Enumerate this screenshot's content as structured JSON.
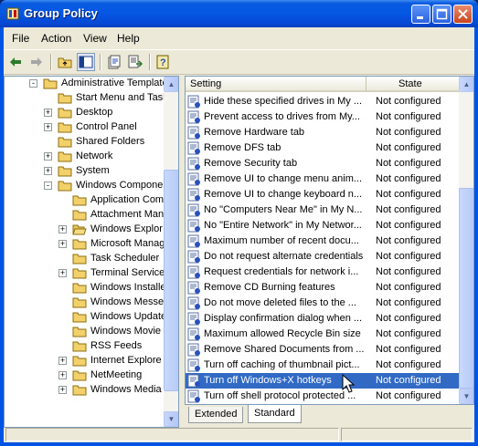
{
  "window": {
    "title": "Group Policy"
  },
  "menu": [
    "File",
    "Action",
    "View",
    "Help"
  ],
  "tree": [
    {
      "label": "Administrative Template",
      "indent": 2,
      "exp": "-"
    },
    {
      "label": "Start Menu and Taskb",
      "indent": 3,
      "exp": ""
    },
    {
      "label": "Desktop",
      "indent": 3,
      "exp": "+"
    },
    {
      "label": "Control Panel",
      "indent": 3,
      "exp": "+"
    },
    {
      "label": "Shared Folders",
      "indent": 3,
      "exp": ""
    },
    {
      "label": "Network",
      "indent": 3,
      "exp": "+"
    },
    {
      "label": "System",
      "indent": 3,
      "exp": "+"
    },
    {
      "label": "Windows Componen",
      "indent": 3,
      "exp": "-"
    },
    {
      "label": "Application Com",
      "indent": 4,
      "exp": ""
    },
    {
      "label": "Attachment Man",
      "indent": 4,
      "exp": ""
    },
    {
      "label": "Windows Explor",
      "indent": 4,
      "exp": "+",
      "open": true
    },
    {
      "label": "Microsoft Manag",
      "indent": 4,
      "exp": "+"
    },
    {
      "label": "Task Scheduler",
      "indent": 4,
      "exp": ""
    },
    {
      "label": "Terminal Service",
      "indent": 4,
      "exp": "+"
    },
    {
      "label": "Windows Installe",
      "indent": 4,
      "exp": ""
    },
    {
      "label": "Windows Messe",
      "indent": 4,
      "exp": ""
    },
    {
      "label": "Windows Update",
      "indent": 4,
      "exp": ""
    },
    {
      "label": "Windows Movie",
      "indent": 4,
      "exp": ""
    },
    {
      "label": "RSS Feeds",
      "indent": 4,
      "exp": ""
    },
    {
      "label": "Internet Explore",
      "indent": 4,
      "exp": "+"
    },
    {
      "label": "NetMeeting",
      "indent": 4,
      "exp": "+"
    },
    {
      "label": "Windows Media",
      "indent": 4,
      "exp": "+"
    }
  ],
  "list": {
    "col_setting": "Setting",
    "col_state": "State",
    "rows": [
      {
        "name": "Hide these specified drives in My ...",
        "state": "Not configured"
      },
      {
        "name": "Prevent access to drives from My...",
        "state": "Not configured"
      },
      {
        "name": "Remove Hardware tab",
        "state": "Not configured"
      },
      {
        "name": "Remove DFS tab",
        "state": "Not configured"
      },
      {
        "name": "Remove Security tab",
        "state": "Not configured"
      },
      {
        "name": "Remove UI to change menu anim...",
        "state": "Not configured"
      },
      {
        "name": "Remove UI to change keyboard n...",
        "state": "Not configured"
      },
      {
        "name": "No \"Computers Near Me\" in My N...",
        "state": "Not configured"
      },
      {
        "name": "No \"Entire Network\" in My Networ...",
        "state": "Not configured"
      },
      {
        "name": "Maximum number of recent docu...",
        "state": "Not configured"
      },
      {
        "name": "Do not request alternate credentials",
        "state": "Not configured"
      },
      {
        "name": "Request credentials for network i...",
        "state": "Not configured"
      },
      {
        "name": "Remove CD Burning features",
        "state": "Not configured"
      },
      {
        "name": "Do not move deleted files to the ...",
        "state": "Not configured"
      },
      {
        "name": "Display confirmation dialog when ...",
        "state": "Not configured"
      },
      {
        "name": "Maximum allowed Recycle Bin size",
        "state": "Not configured"
      },
      {
        "name": "Remove Shared Documents from ...",
        "state": "Not configured"
      },
      {
        "name": "Turn off caching of thumbnail pict...",
        "state": "Not configured"
      },
      {
        "name": "Turn off Windows+X hotkeys",
        "state": "Not configured",
        "selected": true
      },
      {
        "name": "Turn off shell protocol protected ...",
        "state": "Not configured"
      }
    ]
  },
  "tabs": [
    {
      "label": "Extended"
    },
    {
      "label": "Standard",
      "active": true
    }
  ]
}
